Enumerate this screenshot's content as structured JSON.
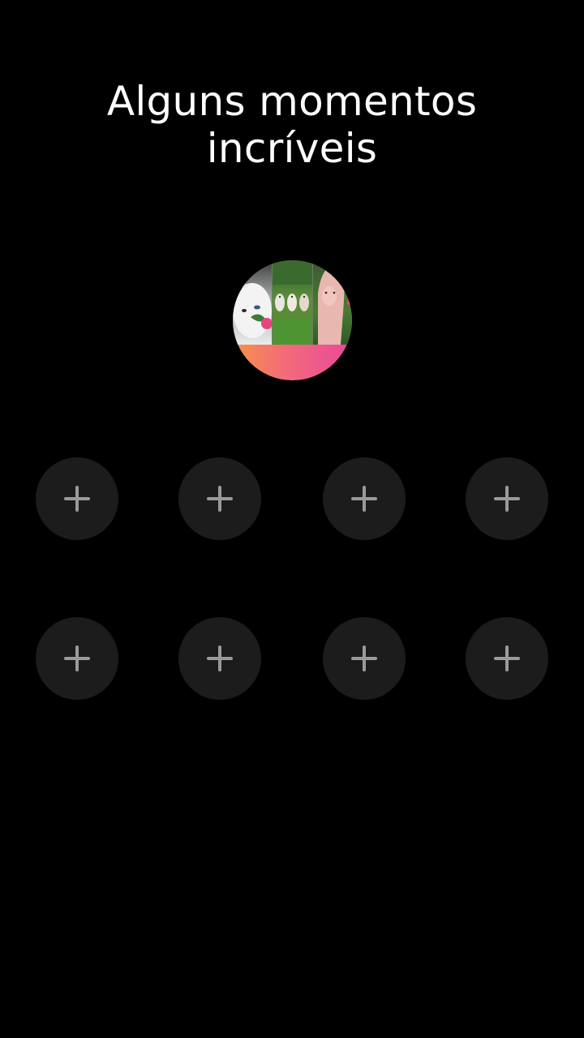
{
  "header": {
    "title_line1": "Alguns momentos",
    "title_line2": "incríveis"
  },
  "highlight": {
    "cover_icon": "photo-collage",
    "gradient_colors": [
      "#f6934a",
      "#f36a7a",
      "#e8489c"
    ]
  },
  "slots": {
    "icon": "plus-icon",
    "count": 8,
    "background": "#1c1c1c",
    "icon_color": "#9a9a9a"
  },
  "colors": {
    "background": "#000000",
    "text": "#ffffff"
  }
}
